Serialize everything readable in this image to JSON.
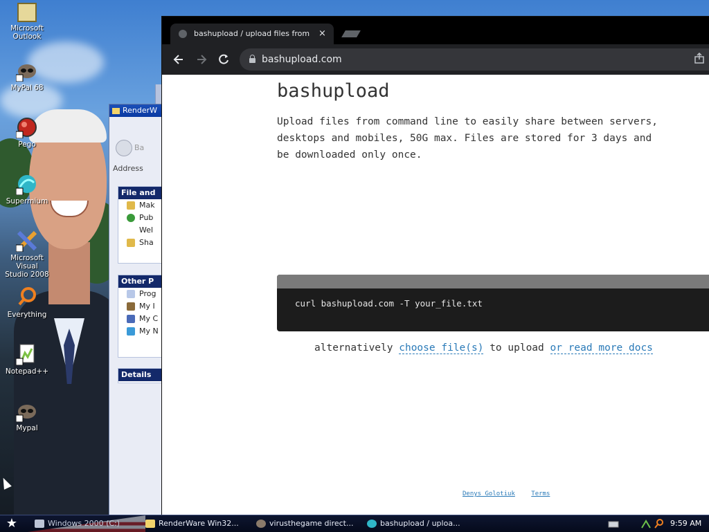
{
  "desktop": {
    "icons": [
      {
        "label": "Microsoft\nOutlook"
      },
      {
        "label": "MyPal 68"
      },
      {
        "label": "Pego"
      },
      {
        "label": "Supermium"
      },
      {
        "label": "Microsoft Visual\nStudio 2008"
      },
      {
        "label": "Everything"
      },
      {
        "label": "Notepad++"
      },
      {
        "label": "Mypal"
      }
    ]
  },
  "explorer": {
    "title": "RenderW",
    "back_label": "Ba",
    "address_label": "Address",
    "panels": [
      {
        "header": "File and",
        "items": [
          "Mak",
          "Pub",
          "Wel",
          "Sha"
        ]
      },
      {
        "header": "Other P",
        "items": [
          "Prog",
          "My I",
          "My C",
          "My N"
        ]
      },
      {
        "header": "Details",
        "items": []
      }
    ]
  },
  "browser": {
    "tab_title": "bashupload / upload files from comm",
    "tab_close": "×",
    "url": "bashupload.com",
    "icons": {
      "back": "arrow-left-icon",
      "forward": "arrow-right-icon",
      "reload": "reload-icon",
      "lock": "lock-icon",
      "share": "share-icon"
    },
    "page": {
      "title": "bashupload",
      "description_line1": "Upload files from command line to easily share between servers,",
      "description_line2": "desktops and mobiles, 50G max. Files are stored for 3 days and",
      "description_line3": "be downloaded only once.",
      "command": "curl bashupload.com -T your_file.txt",
      "alt_prefix": "alternatively",
      "choose_link": "choose file(s)",
      "alt_middle": "to upload",
      "docs_link": "or read more docs",
      "footer_author": "Denys Golotiuk",
      "footer_terms": "Terms"
    }
  },
  "taskbar": {
    "start_icon": "star-icon",
    "buttons": [
      {
        "label": "Windows 2000 (C:)"
      },
      {
        "label": "RenderWare Win32..."
      },
      {
        "label": "virusthegame direct..."
      },
      {
        "label": "bashupload / uploa..."
      }
    ],
    "clock": "9:59 AM"
  },
  "colors": {
    "link": "#2a7ab8",
    "chrome_dark": "#202124",
    "code_bg": "#1c1c1c"
  }
}
